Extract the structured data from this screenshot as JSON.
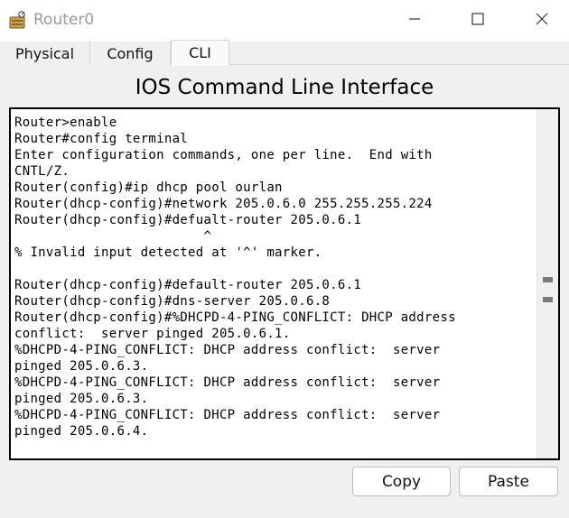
{
  "window": {
    "title": "Router0",
    "icon": "router-icon",
    "controls": {
      "minimize": "minimize-icon",
      "maximize": "maximize-icon",
      "close": "close-icon"
    }
  },
  "tabs": [
    {
      "label": "Physical",
      "active": false
    },
    {
      "label": "Config",
      "active": false
    },
    {
      "label": "CLI",
      "active": true
    }
  ],
  "cli": {
    "heading": "IOS Command Line Interface",
    "lines": [
      "Router>enable",
      "Router#config terminal",
      "Enter configuration commands, one per line.  End with",
      "CNTL/Z.",
      "Router(config)#ip dhcp pool ourlan",
      "Router(dhcp-config)#network 205.0.6.0 255.255.255.224",
      "Router(dhcp-config)#defualt-router 205.0.6.1",
      "                        ^",
      "% Invalid input detected at '^' marker.",
      "",
      "Router(dhcp-config)#default-router 205.0.6.1",
      "Router(dhcp-config)#dns-server 205.0.6.8",
      "Router(dhcp-config)#%DHCPD-4-PING_CONFLICT: DHCP address",
      "conflict:  server pinged 205.0.6.1.",
      "%DHCPD-4-PING_CONFLICT: DHCP address conflict:  server",
      "pinged 205.0.6.3.",
      "%DHCPD-4-PING_CONFLICT: DHCP address conflict:  server",
      "pinged 205.0.6.3.",
      "%DHCPD-4-PING_CONFLICT: DHCP address conflict:  server",
      "pinged 205.0.6.4."
    ]
  },
  "buttons": {
    "copy": "Copy",
    "paste": "Paste"
  },
  "colors": {
    "terminal_bg": "#ffffff",
    "window_bg": "#f0f0f0",
    "title_text": "#9a9a9a"
  }
}
